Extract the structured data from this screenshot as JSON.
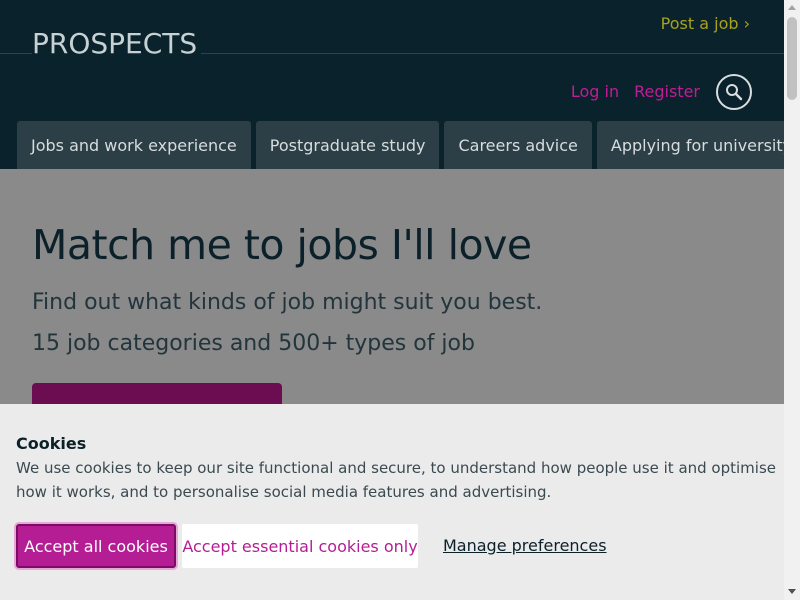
{
  "header": {
    "logo": "PROSPECTS",
    "post_job": "Post a job ›",
    "login": "Log in",
    "register": "Register",
    "search_icon": "search-icon"
  },
  "nav": {
    "tabs": [
      {
        "label": "Jobs and work experience"
      },
      {
        "label": "Postgraduate study"
      },
      {
        "label": "Careers advice"
      },
      {
        "label": "Applying for university"
      }
    ]
  },
  "hero": {
    "title": "Match me to jobs I'll love",
    "line1": "Find out what kinds of job might suit you best.",
    "line2": "15 job categories and 500+ types of job"
  },
  "cookie": {
    "title": "Cookies",
    "description": "We use cookies to keep our site functional and secure, to understand how people use it and optimise how it works, and to personalise social media features and advertising.",
    "accept_all": "Accept all cookies",
    "accept_essential": "Accept essential cookies only",
    "manage": "Manage preferences"
  },
  "colors": {
    "header_bg": "#0a222b",
    "accent": "#b41d93",
    "post_job": "#a7a21f"
  }
}
